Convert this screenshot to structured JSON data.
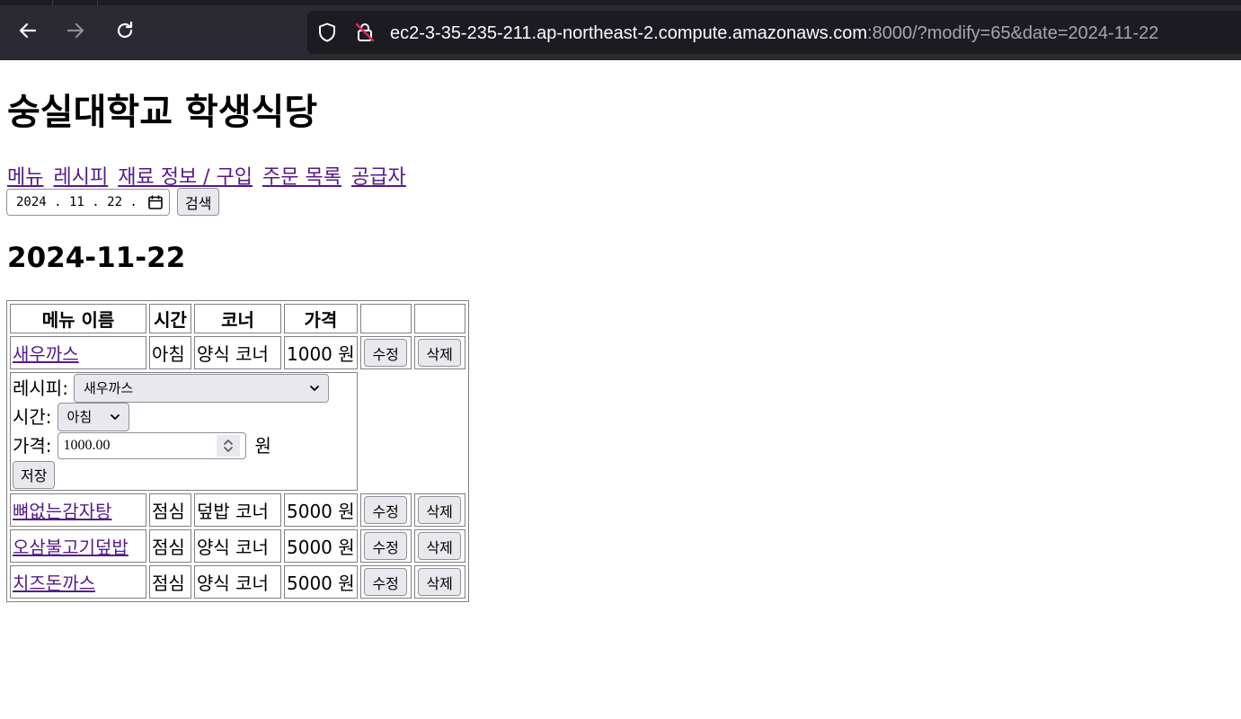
{
  "browser": {
    "url_host": "ec2-3-35-235-211.ap-northeast-2.compute.amazonaws.com",
    "url_rest": ":8000/?modify=65&date=2024-11-22"
  },
  "page": {
    "title": "숭실대학교 학생식당",
    "nav": [
      "메뉴",
      "레시피",
      "재료 정보 / 구입",
      "주문 목록",
      "공급자"
    ],
    "date_value": "2024 .  11 .  22 .",
    "search_label": "검색",
    "date_heading": "2024-11-22"
  },
  "table": {
    "headers": [
      "메뉴 이름",
      "시간",
      "코너",
      "가격",
      "",
      ""
    ],
    "edit_label": "수정",
    "delete_label": "삭제",
    "rows": [
      {
        "name": "새우까스",
        "time": "아침",
        "corner": "양식 코너",
        "price": "1000 원"
      },
      {
        "name": "뼈없는감자탕",
        "time": "점심",
        "corner": "덮밥 코너",
        "price": "5000 원"
      },
      {
        "name": "오삼불고기덮밥",
        "time": "점심",
        "corner": "양식 코너",
        "price": "5000 원"
      },
      {
        "name": "치즈돈까스",
        "time": "점심",
        "corner": "양식 코너",
        "price": "5000 원"
      }
    ],
    "edit_form": {
      "recipe_label": "레시피:",
      "recipe_value": "새우까스",
      "time_label": "시간:",
      "time_value": "아침",
      "price_label": "가격:",
      "price_value": "1000.00",
      "price_unit": "원",
      "save_label": "저장"
    }
  }
}
